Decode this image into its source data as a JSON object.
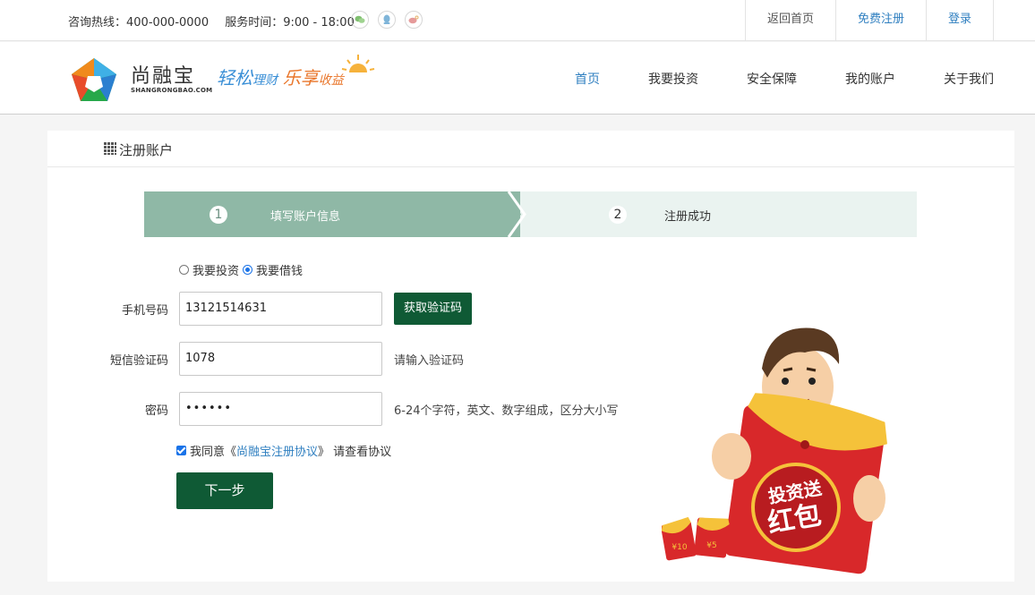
{
  "topbar": {
    "hotline": "咨询热线：400-000-0000",
    "service_time": "服务时间：9:00 - 18:00",
    "social_icons": [
      "wechat-icon",
      "qq-icon",
      "weibo-icon"
    ],
    "links": [
      "返回首页",
      "免费注册",
      "登录"
    ]
  },
  "header": {
    "brand_name": "尚融宝",
    "brand_domain": "SHANGRONGBAO.COM",
    "slogan": [
      "轻松",
      "理财",
      "乐享",
      "收益"
    ],
    "nav": [
      "首页",
      "我要投资",
      "安全保障",
      "我的账户",
      "关于我们"
    ]
  },
  "panel": {
    "title": "注册账户",
    "steps": [
      {
        "number": "1",
        "label": "填写账户信息"
      },
      {
        "number": "2",
        "label": "注册成功"
      }
    ],
    "role_options": [
      "我要投资",
      "我要借钱"
    ],
    "role_selected": "我要借钱",
    "phone_label": "手机号码",
    "phone_value": "13121514631",
    "get_code_button": "获取验证码",
    "sms_label": "短信验证码",
    "sms_value": "1078",
    "sms_hint": "请输入验证码",
    "password_label": "密码",
    "password_value": "••••••",
    "password_hint": "6-24个字符，英文、数字组成，区分大小写",
    "agree_prefix": "我同意《",
    "agree_link": "尚融宝注册协议",
    "agree_suffix": "》 请查看协议",
    "agree_checked": true,
    "next_button": "下一步"
  },
  "promo": {
    "text_line1": "投资送",
    "text_line2": "红包",
    "small_envelopes": [
      "¥10",
      "¥5"
    ]
  },
  "colors": {
    "primary_green": "#0f5a35",
    "step_active": "#8fb8a6",
    "step_inactive": "#eaf3f0",
    "link_blue": "#2f7fc0",
    "envelope_red": "#d8282a"
  }
}
